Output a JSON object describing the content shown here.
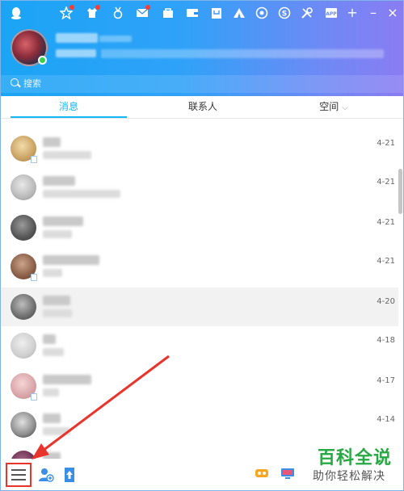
{
  "search": {
    "placeholder": "搜索"
  },
  "tabs": [
    {
      "label": "消息",
      "active": true
    },
    {
      "label": "联系人",
      "active": false
    },
    {
      "label": "空间",
      "active": false
    }
  ],
  "conversations": [
    {
      "date": "4-21"
    },
    {
      "date": "4-21"
    },
    {
      "date": "4-21"
    },
    {
      "date": "4-21"
    },
    {
      "date": "4-20"
    },
    {
      "date": "4-18"
    },
    {
      "date": "4-17"
    },
    {
      "date": "4-14"
    }
  ],
  "watermark": {
    "title": "百科全说",
    "subtitle": "助你轻松解决"
  },
  "colors": {
    "accent": "#12b7f5",
    "highlight": "#e8342b",
    "watermark": "#26a842"
  },
  "icons": [
    "qq-icon",
    "star-icon",
    "shirt-icon",
    "medal-icon",
    "mail-icon",
    "shop-icon",
    "wallet-icon",
    "bag-icon",
    "tent-icon",
    "music-icon",
    "s-icon",
    "tools-icon",
    "app-icon",
    "plus-icon",
    "minimize-icon",
    "close-icon",
    "menu-icon",
    "add-contact-icon",
    "upload-icon",
    "game-icon",
    "screen-icon"
  ]
}
